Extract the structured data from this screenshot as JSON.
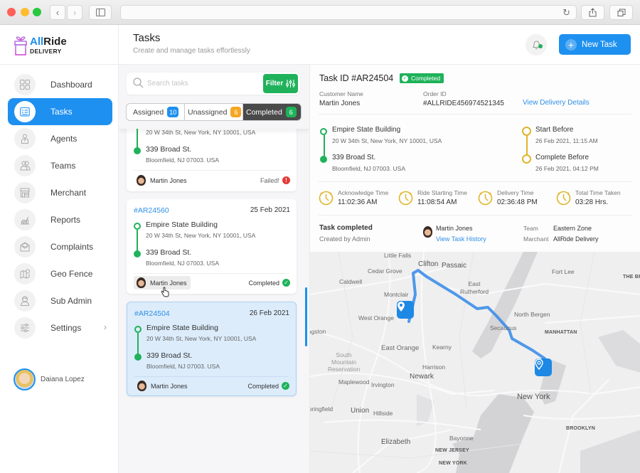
{
  "browser": {
    "back_icon": "chevron-left-icon",
    "forward_icon": "chevron-right-icon",
    "sidebar_icon": "sidebar-toggle-icon",
    "reload_icon": "reload-icon",
    "share_icon": "share-icon",
    "tabs_icon": "tabs-overview-icon"
  },
  "brand": {
    "name_part1": "All",
    "name_part2": "Ride",
    "subtitle": "DELIVERY",
    "accent": "#1e90f0"
  },
  "sidebar": {
    "items": [
      {
        "label": "Dashboard",
        "icon": "grid-icon",
        "active": false
      },
      {
        "label": "Tasks",
        "icon": "task-list-icon",
        "active": true
      },
      {
        "label": "Agents",
        "icon": "agent-icon",
        "active": false
      },
      {
        "label": "Teams",
        "icon": "team-icon",
        "active": false
      },
      {
        "label": "Merchant",
        "icon": "store-icon",
        "active": false
      },
      {
        "label": "Reports",
        "icon": "chart-icon",
        "active": false
      },
      {
        "label": "Complaints",
        "icon": "complaint-envelope-icon",
        "active": false
      },
      {
        "label": "Geo Fence",
        "icon": "map-pin-icon",
        "active": false
      },
      {
        "label": "Sub Admin",
        "icon": "admin-user-icon",
        "active": false
      },
      {
        "label": "Settings",
        "icon": "sliders-icon",
        "active": false,
        "has_submenu": true
      }
    ],
    "user": {
      "name": "Daiana Lopez"
    }
  },
  "header": {
    "title": "Tasks",
    "subtitle": "Create and manage tasks effortlessly",
    "new_task_label": "New Task",
    "notification_dot": true
  },
  "task_list": {
    "search_placeholder": "Search tasks",
    "filter_label": "Filter",
    "tabs": [
      {
        "label": "Assigned",
        "count": "10",
        "color": "#1e90f0",
        "active": false
      },
      {
        "label": "Unassigned",
        "count": "6",
        "color": "#f5a623",
        "active": false
      },
      {
        "label": "Completed",
        "count": "6",
        "color": "#1fb25a",
        "active": true
      }
    ],
    "cards": [
      {
        "id": "",
        "date": "",
        "pickup": {
          "name": "",
          "address": "20 W 34th St, New York, NY 10001, USA"
        },
        "dropoff": {
          "name": "339 Broad St.",
          "address": "Bloomfield, NJ 07003. USA"
        },
        "agent": "Martin Jones",
        "status": "Failed!",
        "status_color": "#e53935"
      },
      {
        "id": "#AR24560",
        "date": "25 Feb 2021",
        "pickup": {
          "name": "Empire State Building",
          "address": "20 W 34th St, New York, NY 10001, USA"
        },
        "dropoff": {
          "name": "339 Broad St.",
          "address": "Bloomfield, NJ 07003. USA"
        },
        "agent": "Martin Jones",
        "status": "Completed",
        "status_color": "#1fb25a"
      },
      {
        "id": "#AR24504",
        "date": "26 Feb 2021",
        "pickup": {
          "name": "Empire State Building",
          "address": "20 W 34th St, New York, NY 10001, USA"
        },
        "dropoff": {
          "name": "339 Broad St.",
          "address": "Bloomfield, NJ 07003. USA"
        },
        "agent": "Martin Jones",
        "status": "Completed",
        "status_color": "#1fb25a",
        "selected": true
      }
    ]
  },
  "detail": {
    "title": "Task ID #AR24504",
    "status_badge": "Completed",
    "customer_label": "Customer Name",
    "customer_value": "Martin Jones",
    "order_label": "Order ID",
    "order_value": "#ALLRIDE456974521345",
    "delivery_link": "View Delivery Details",
    "pickup": {
      "name": "Empire State Building",
      "address": "20 W 34th St, New York, NY 10001, USA"
    },
    "dropoff": {
      "name": "339 Broad St.",
      "address": "Bloomfield, NJ 07003. USA"
    },
    "start_before_label": "Start Before",
    "start_before_value": "26 Feb 2021, 11:15 AM",
    "complete_before_label": "Complete Before",
    "complete_before_value": "26 Feb 2021, 04:12 PM",
    "timers": [
      {
        "label": "Acknowledge Time",
        "value": "11:02:36 AM"
      },
      {
        "label": "Ride Starting Time",
        "value": "11:08:54 AM"
      },
      {
        "label": "Delivery Time",
        "value": "02:36:48 PM"
      },
      {
        "label": "Total Time Taken",
        "value": "03:28 Hrs."
      }
    ],
    "task_status_title": "Task completed",
    "created_by": "Created by Admin",
    "agent_name": "Martin Jones",
    "history_link": "View Task History",
    "team_label": "Team",
    "team_value": "Eastern Zone",
    "merchant_label": "Marchant",
    "merchant_value": "AllRide Delivery"
  },
  "map": {
    "labels": [
      {
        "text": "Little Falls",
        "style": "normal"
      },
      {
        "text": "Clifton",
        "style": "big"
      },
      {
        "text": "Passaic",
        "style": "big"
      },
      {
        "text": "Cedar Grove",
        "style": "normal"
      },
      {
        "text": "Caldwell",
        "style": "normal"
      },
      {
        "text": "East Rutherford",
        "style": "normal"
      },
      {
        "text": "Montclair",
        "style": "normal"
      },
      {
        "text": "West Orange",
        "style": "normal"
      },
      {
        "text": "Fort Lee",
        "style": "normal"
      },
      {
        "text": "North Bergen",
        "style": "normal"
      },
      {
        "text": "Secaucus",
        "style": "normal"
      },
      {
        "text": "MANHATTAN",
        "style": "caps"
      },
      {
        "text": "East Orange",
        "style": "normal"
      },
      {
        "text": "Kearny",
        "style": "normal"
      },
      {
        "text": "South Mountain Reservation",
        "style": "normal"
      },
      {
        "text": "Harrison",
        "style": "normal"
      },
      {
        "text": "Newark",
        "style": "big"
      },
      {
        "text": "Maplewood",
        "style": "normal"
      },
      {
        "text": "Irvington",
        "style": "normal"
      },
      {
        "text": "Springfield",
        "style": "normal"
      },
      {
        "text": "Union",
        "style": "big"
      },
      {
        "text": "Hillside",
        "style": "normal"
      },
      {
        "text": "Elizabeth",
        "style": "big"
      },
      {
        "text": "Bayonne",
        "style": "normal"
      },
      {
        "text": "NEW JERSEY",
        "style": "caps"
      },
      {
        "text": "NEW YORK",
        "style": "caps"
      },
      {
        "text": "New York",
        "style": "big"
      },
      {
        "text": "BROOKLYN",
        "style": "caps"
      },
      {
        "text": "THE BRONX",
        "style": "caps"
      },
      {
        "text": "Livingston",
        "style": "normal"
      }
    ],
    "route_color": "#3d8ee8",
    "pins": [
      {
        "name": "pickup-pin"
      },
      {
        "name": "dropoff-pin"
      }
    ]
  }
}
